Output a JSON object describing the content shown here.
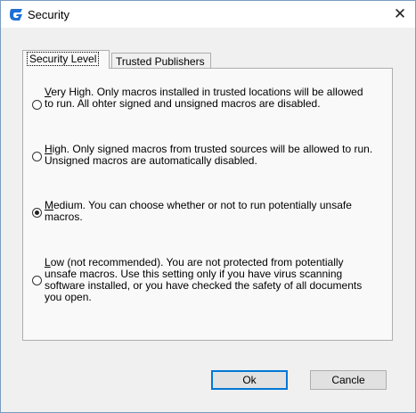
{
  "window": {
    "title": "Security",
    "close_glyph": "✕"
  },
  "tabs": [
    {
      "label": "Security Level",
      "active": true
    },
    {
      "label": "Trusted Publishers",
      "active": false
    }
  ],
  "options": [
    {
      "mnemonic": "V",
      "rest": "ery High. Only macros installed in trusted locations will be allowed to run. All ohter signed and unsigned macros are disabled.",
      "checked": false
    },
    {
      "mnemonic": "H",
      "rest": "igh. Only signed macros from trusted sources will be allowed to run. Unsigned macros are automatically disabled.",
      "checked": false
    },
    {
      "mnemonic": "M",
      "rest": "edium. You can choose whether or not to run potentially unsafe macros.",
      "checked": true
    },
    {
      "mnemonic": "L",
      "rest": "ow (not recommended). You are not protected from potentially unsafe macros. Use this setting only if you have virus scanning software installed, or you have checked the safety of all documents you open.",
      "checked": false
    }
  ],
  "buttons": {
    "ok": "Ok",
    "cancel": "Cancle"
  },
  "colors": {
    "accent": "#0078d7",
    "icon_blue": "#1e6fd6"
  },
  "icons": {
    "app": "app-logo-icon",
    "close": "close-icon"
  }
}
